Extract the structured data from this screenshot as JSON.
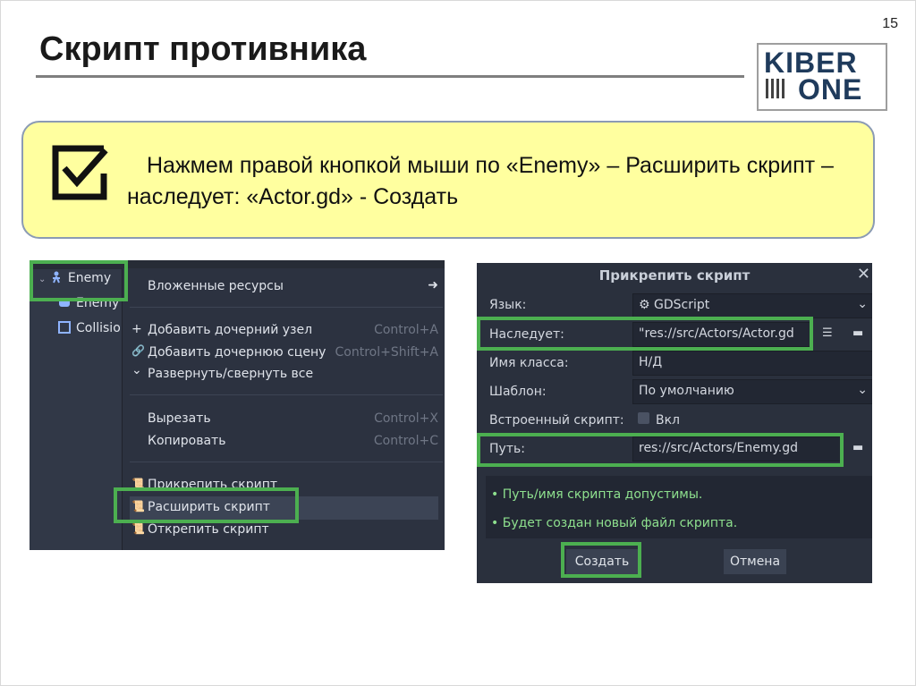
{
  "slide": {
    "title": "Скрипт противника",
    "page_number": "15",
    "logo": {
      "line1": "KIBER",
      "line2": "ONE",
      "colors": {
        "text": "#1f3b5c",
        "accent": "#f2c200"
      }
    },
    "instruction": "Нажмем правой кнопкой мыши по «Enemy» – Расширить скрипт – наследует: «Actor.gd» - Создать",
    "callout_icon": "checkbox-check-icon",
    "colors": {
      "callout_bg": "#ffff9f",
      "highlight": "#4caf50"
    }
  },
  "scene_tree": {
    "items": [
      {
        "label": "Enemy",
        "icon": "person-run-icon"
      },
      {
        "label": "Enemy",
        "icon": "sprite-icon"
      },
      {
        "label": "Collisio",
        "icon": "collision-shape-icon"
      }
    ]
  },
  "context_menu": {
    "items": [
      {
        "label": "Вложенные ресурсы",
        "icon": "",
        "shortcut": "",
        "arrow": "➜"
      },
      {
        "label": "Добавить дочерний узел",
        "icon": "+",
        "shortcut": "Control+A"
      },
      {
        "label": "Добавить дочернюю сцену",
        "icon": "🔗",
        "shortcut": "Control+Shift+A"
      },
      {
        "label": "Развернуть/свернуть все",
        "icon": "⌄",
        "shortcut": ""
      },
      {
        "label": "Вырезать",
        "icon": "",
        "shortcut": "Control+X"
      },
      {
        "label": "Копировать",
        "icon": "",
        "shortcut": "Control+C"
      },
      {
        "label": "Прикрепить скрипт",
        "icon": "📜",
        "shortcut": ""
      },
      {
        "label": "Расширить скрипт",
        "icon": "📜",
        "shortcut": ""
      },
      {
        "label": "Открепить скрипт",
        "icon": "📜",
        "shortcut": ""
      }
    ]
  },
  "dialog": {
    "title": "Прикрепить скрипт",
    "close": "✕",
    "fields": [
      {
        "label": "Язык:",
        "value": "⚙ GDScript",
        "dropdown": true
      },
      {
        "label": "Наследует:",
        "value": "\"res://src/Actors/Actor.gd",
        "dropdown": false
      },
      {
        "label": "Имя класса:",
        "value": "Н/Д",
        "dropdown": false
      },
      {
        "label": "Шаблон:",
        "value": "По умолчанию",
        "dropdown": true
      },
      {
        "label": "Встроенный скрипт:",
        "value": "Вкл",
        "checkbox": true
      },
      {
        "label": "Путь:",
        "value": "res://src/Actors/Enemy.gd",
        "dropdown": false
      }
    ],
    "messages": [
      "• Путь/имя скрипта допустимы.",
      "• Будет создан новый файл скрипта."
    ],
    "create_button": "Создать",
    "cancel_button": "Отмена"
  }
}
